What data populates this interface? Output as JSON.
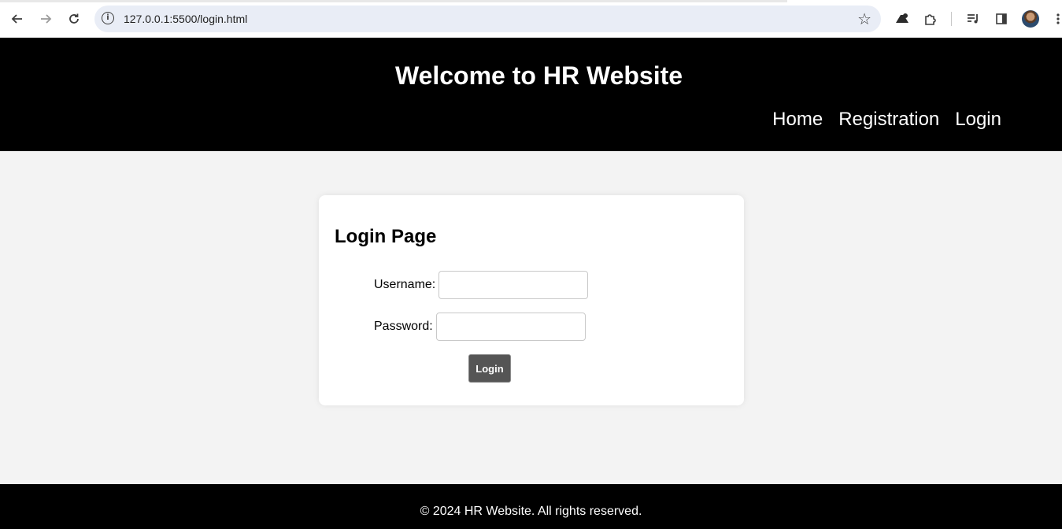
{
  "browser": {
    "url": "127.0.0.1:5500/login.html",
    "back_icon": "arrow-left-icon",
    "forward_icon": "arrow-right-icon",
    "reload_icon": "reload-icon",
    "info_icon": "info-icon",
    "bookmark_icon": "star-icon",
    "extension_icons": [
      "puzzle-extension-icon",
      "extensions-icon",
      "media-controls-icon",
      "side-panel-icon",
      "profile-avatar-icon",
      "kebab-menu-icon"
    ]
  },
  "header": {
    "title": "Welcome to HR Website",
    "nav": [
      {
        "label": "Home"
      },
      {
        "label": "Registration"
      },
      {
        "label": "Login"
      }
    ],
    "background": "#000000",
    "text_color": "#ffffff"
  },
  "main": {
    "heading": "Login Page",
    "username_label": "Username:",
    "username_value": "",
    "password_label": "Password:",
    "password_value": "",
    "submit_label": "Login",
    "button_color": "#555555"
  },
  "footer": {
    "text": "© 2024 HR Website. All rights reserved."
  },
  "colors": {
    "page_background": "#f3f3f3",
    "card_background": "#ffffff"
  }
}
